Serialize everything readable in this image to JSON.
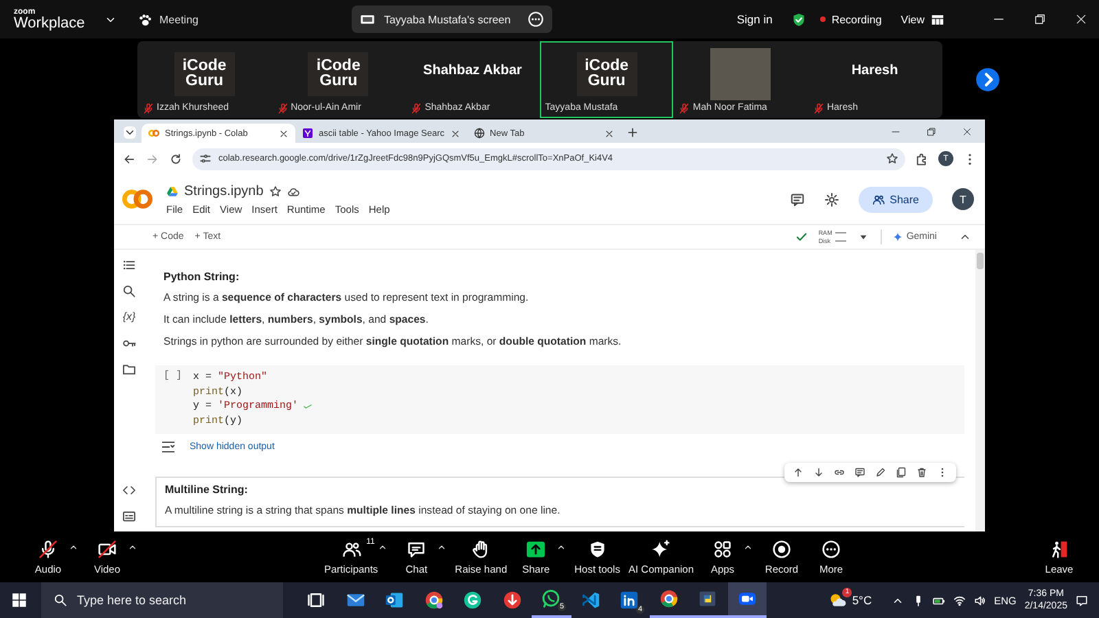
{
  "zoom_bar": {
    "brand_small": "zoom",
    "brand": "Workplace",
    "meeting": "Meeting",
    "screen_label": "Tayyaba Mustafa's screen",
    "sign_in": "Sign in",
    "recording": "Recording",
    "view": "View"
  },
  "participants": [
    {
      "kind": "logo",
      "logo_text": "iCode Guru",
      "name": "Izzah Khursheed",
      "muted": true,
      "selected": false
    },
    {
      "kind": "logo",
      "logo_text": "iCode Guru",
      "name": "Noor-ul-Ain Amir",
      "muted": true,
      "selected": false
    },
    {
      "kind": "name",
      "display_name": "Shahbaz Akbar",
      "name": "Shahbaz Akbar",
      "muted": true,
      "selected": false
    },
    {
      "kind": "logo",
      "logo_text": "iCode Guru",
      "name": "Tayyaba Mustafa",
      "muted": false,
      "selected": true
    },
    {
      "kind": "photo",
      "name": "Mah Noor Fatima",
      "muted": true,
      "selected": false
    },
    {
      "kind": "name",
      "display_name": "Haresh",
      "name": "Haresh",
      "muted": true,
      "selected": false
    }
  ],
  "browser": {
    "tabs": [
      {
        "kind": "colab",
        "title": "Strings.ipynb - Colab",
        "selected": true
      },
      {
        "kind": "yahoo",
        "title": "ascii table - Yahoo Image Searc",
        "selected": false
      },
      {
        "kind": "globe",
        "title": "New Tab",
        "selected": false
      }
    ],
    "url": "colab.research.google.com/drive/1rZgJreetFdc98n9PyjGQsmVf5u_EmgkL#scrollTo=XnPaOf_Ki4V4",
    "profile": "T"
  },
  "colab": {
    "filename": "Strings.ipynb",
    "menu": [
      "File",
      "Edit",
      "View",
      "Insert",
      "Runtime",
      "Tools",
      "Help"
    ],
    "share": "Share",
    "avatar": "T",
    "add_buttons": [
      "+ Code",
      "+ Text"
    ],
    "ram": "RAM",
    "disk": "Disk",
    "gemini": "Gemini",
    "variables_glyph": "{x}",
    "cells": [
      {
        "kind": "text",
        "selected": false,
        "heading": "Python String:",
        "paragraphs": [
          "A string is a **sequence of characters** used to represent text in programming.",
          "It can include **letters**, **numbers**, **symbols**, and **spaces**.",
          "Strings in python are surrounded by either **single quotation** marks, or **double quotation** marks."
        ]
      },
      {
        "kind": "code",
        "selected": false,
        "prompt": "[ ]",
        "lines": [
          {
            "code": "x = \"Python\"",
            "annotated": false
          },
          {
            "code": "print(x)",
            "annotated": false
          },
          {
            "code": "y = 'Programming'",
            "annotated": true
          },
          {
            "code": "print(y)",
            "annotated": false
          }
        ],
        "output_toggle": "Show hidden output"
      },
      {
        "kind": "text",
        "selected": true,
        "heading": "Multiline String:",
        "paragraphs": [
          "A multiline string is a string that spans **multiple lines** instead of staying on one line."
        ]
      }
    ]
  },
  "toolbar": [
    {
      "kind": "audio",
      "label": "Audio",
      "off": true,
      "caret": true
    },
    {
      "kind": "video",
      "label": "Video",
      "off": true,
      "caret": true
    },
    {
      "kind": "participants",
      "label": "Participants",
      "count": "11",
      "off": false,
      "caret": true
    },
    {
      "kind": "chat",
      "label": "Chat",
      "off": false,
      "caret": true
    },
    {
      "kind": "raise_hand",
      "label": "Raise hand",
      "off": false,
      "caret": false
    },
    {
      "kind": "share",
      "label": "Share",
      "off": false,
      "caret": true
    },
    {
      "kind": "host_tools",
      "label": "Host tools",
      "off": false,
      "caret": false
    },
    {
      "kind": "ai",
      "label": "AI Companion",
      "off": false,
      "caret": false
    },
    {
      "kind": "apps",
      "label": "Apps",
      "off": false,
      "caret": true
    },
    {
      "kind": "record",
      "label": "Record",
      "off": false,
      "caret": false
    },
    {
      "kind": "more",
      "label": "More",
      "off": false,
      "caret": false
    },
    {
      "kind": "leave",
      "label": "Leave",
      "off": false,
      "caret": false
    }
  ],
  "taskbar": {
    "search_placeholder": "Type here to search",
    "apps": [
      {
        "kind": "taskview",
        "running": false,
        "selected": false
      },
      {
        "kind": "mail",
        "running": false,
        "selected": false
      },
      {
        "kind": "outlook",
        "running": false,
        "selected": false
      },
      {
        "kind": "chrome_profile",
        "running": false,
        "selected": false
      },
      {
        "kind": "grammarly",
        "running": false,
        "selected": false
      },
      {
        "kind": "download",
        "running": false,
        "selected": false
      },
      {
        "kind": "whatsapp",
        "badge": "5",
        "running": true,
        "selected": false
      },
      {
        "kind": "vscode",
        "running": false,
        "selected": false
      },
      {
        "kind": "linkedin",
        "badge": "4",
        "running": false,
        "selected": false
      },
      {
        "kind": "chrome",
        "running": true,
        "selected": false
      },
      {
        "kind": "python",
        "running": true,
        "selected": false
      },
      {
        "kind": "zoom",
        "running": true,
        "selected": true
      }
    ],
    "weather_badge": "1",
    "temperature": "5°C",
    "language": "ENG",
    "time": "7:36 PM",
    "date": "2/14/2025"
  }
}
